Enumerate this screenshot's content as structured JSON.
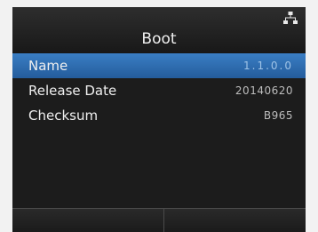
{
  "screen": {
    "title": "Boot",
    "status_icon": "network-icon"
  },
  "items": [
    {
      "label": "Name",
      "value": "1.1.0.0",
      "selected": true
    },
    {
      "label": "Release Date",
      "value": "20140620",
      "selected": false
    },
    {
      "label": "Checksum",
      "value": "B965",
      "selected": false
    }
  ],
  "colors": {
    "background": "#1c1c1c",
    "selection": "#2f6fb3",
    "text": "#efefef",
    "value_text": "#bdbdbd"
  }
}
